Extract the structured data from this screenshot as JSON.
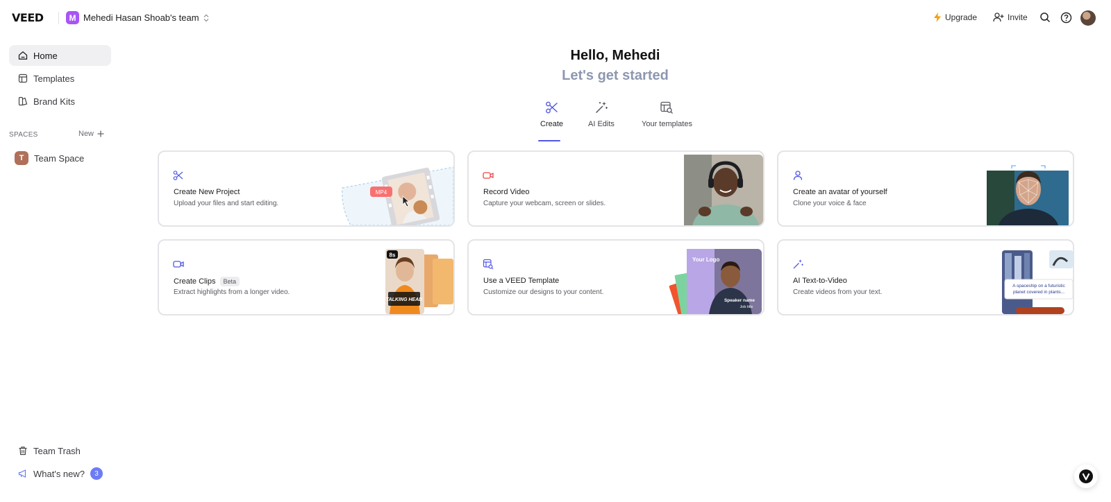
{
  "brand": {
    "logo": "VEED"
  },
  "team": {
    "avatar_letter": "M",
    "name": "Mehedi Hasan Shoab's team"
  },
  "topbar": {
    "upgrade_label": "Upgrade",
    "invite_label": "Invite"
  },
  "sidebar": {
    "items": [
      {
        "label": "Home",
        "icon": "home-icon",
        "active": true
      },
      {
        "label": "Templates",
        "icon": "templates-icon"
      },
      {
        "label": "Brand Kits",
        "icon": "brand-kits-icon"
      }
    ],
    "spaces_label": "SPACES",
    "new_label": "New",
    "space": {
      "badge": "T",
      "label": "Team Space"
    },
    "trash_label": "Team Trash",
    "whats_new_label": "What's new?",
    "whats_new_count": "3"
  },
  "main": {
    "greeting": "Hello, Mehedi",
    "subtitle": "Let's get started",
    "tabs": [
      {
        "label": "Create",
        "icon": "scissors-icon",
        "active": true
      },
      {
        "label": "AI Edits",
        "icon": "magic-wand-icon"
      },
      {
        "label": "Your templates",
        "icon": "your-templates-icon"
      }
    ],
    "cards": [
      {
        "title": "Create New Project",
        "desc": "Upload your files and start editing.",
        "icon": "scissors-icon"
      },
      {
        "title": "Record Video",
        "desc": "Capture your webcam, screen or slides.",
        "icon": "record-icon"
      },
      {
        "title": "Create an avatar of yourself",
        "desc": "Clone your voice & face",
        "icon": "user-icon"
      },
      {
        "title": "Create Clips",
        "badge": "Beta",
        "desc": "Extract highlights from a longer video.",
        "icon": "video-clip-icon"
      },
      {
        "title": "Use a VEED Template",
        "desc": "Customize our designs to your content.",
        "icon": "template-icon"
      },
      {
        "title": "AI Text-to-Video",
        "desc": "Create videos from your text.",
        "icon": "magic-wand-icon"
      }
    ],
    "art": {
      "mp4_tag": "MP4",
      "clip_duration": "8s",
      "talking_head": "TALKING HEAD",
      "your_logo": "Your Logo",
      "speaker_name": "Speaker name",
      "job_title": "Job title",
      "prompt_text": "A spaceship on a futuristic planet covered in plants..."
    }
  },
  "colors": {
    "accent": "#4f56e6",
    "team_avatar": "#a855f7",
    "upgrade_bolt": "#f59e0b",
    "record_red": "#ef4444"
  }
}
